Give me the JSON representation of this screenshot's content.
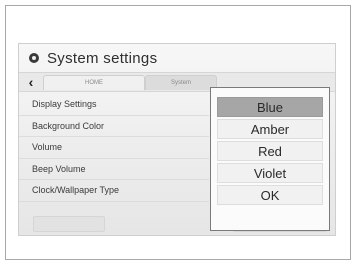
{
  "header": {
    "title": "System settings",
    "icon": "gear-icon"
  },
  "tabs": [
    {
      "label": "HOME"
    },
    {
      "label": "System"
    }
  ],
  "settings": [
    {
      "label": "Display Settings"
    },
    {
      "label": "Background Color"
    },
    {
      "label": "Volume"
    },
    {
      "label": "Beep Volume"
    },
    {
      "label": "Clock/Wallpaper Type"
    }
  ],
  "popup": {
    "options": [
      {
        "label": "Blue",
        "selected": true
      },
      {
        "label": "Amber"
      },
      {
        "label": "Red"
      },
      {
        "label": "Violet"
      },
      {
        "label": "OK"
      }
    ]
  },
  "colors": {
    "selected_option": "#a6a6a6",
    "popup_border": "#7a7a7a"
  }
}
